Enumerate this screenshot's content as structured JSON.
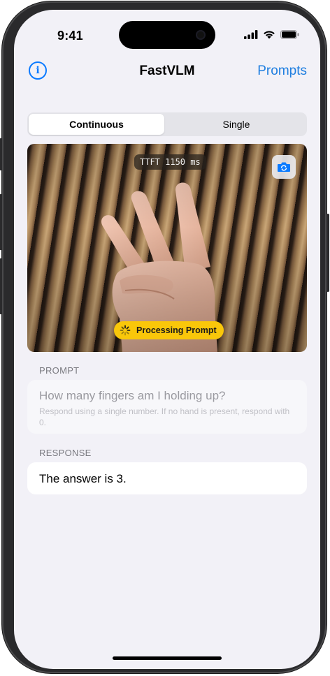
{
  "status_bar": {
    "time": "9:41"
  },
  "nav": {
    "title": "FastVLM",
    "prompts_label": "Prompts",
    "info_glyph": "i"
  },
  "mode": {
    "options": [
      "Continuous",
      "Single"
    ],
    "selected": "Continuous"
  },
  "camera": {
    "ttft": "TTFT 1150 ms",
    "processing_label": "Processing Prompt"
  },
  "prompt": {
    "section_label": "PROMPT",
    "text": "How many fingers am I holding up?",
    "instructions": "Respond using a single number. If no hand is present, respond with 0."
  },
  "response": {
    "section_label": "RESPONSE",
    "text": "The answer is 3."
  },
  "colors": {
    "accent": "#0a7aff",
    "badge": "#f9c70a",
    "background": "#f2f1f7"
  },
  "icons": [
    "info-icon",
    "switch-camera-icon",
    "spinner-icon",
    "signal-icon",
    "wifi-icon",
    "battery-icon"
  ]
}
